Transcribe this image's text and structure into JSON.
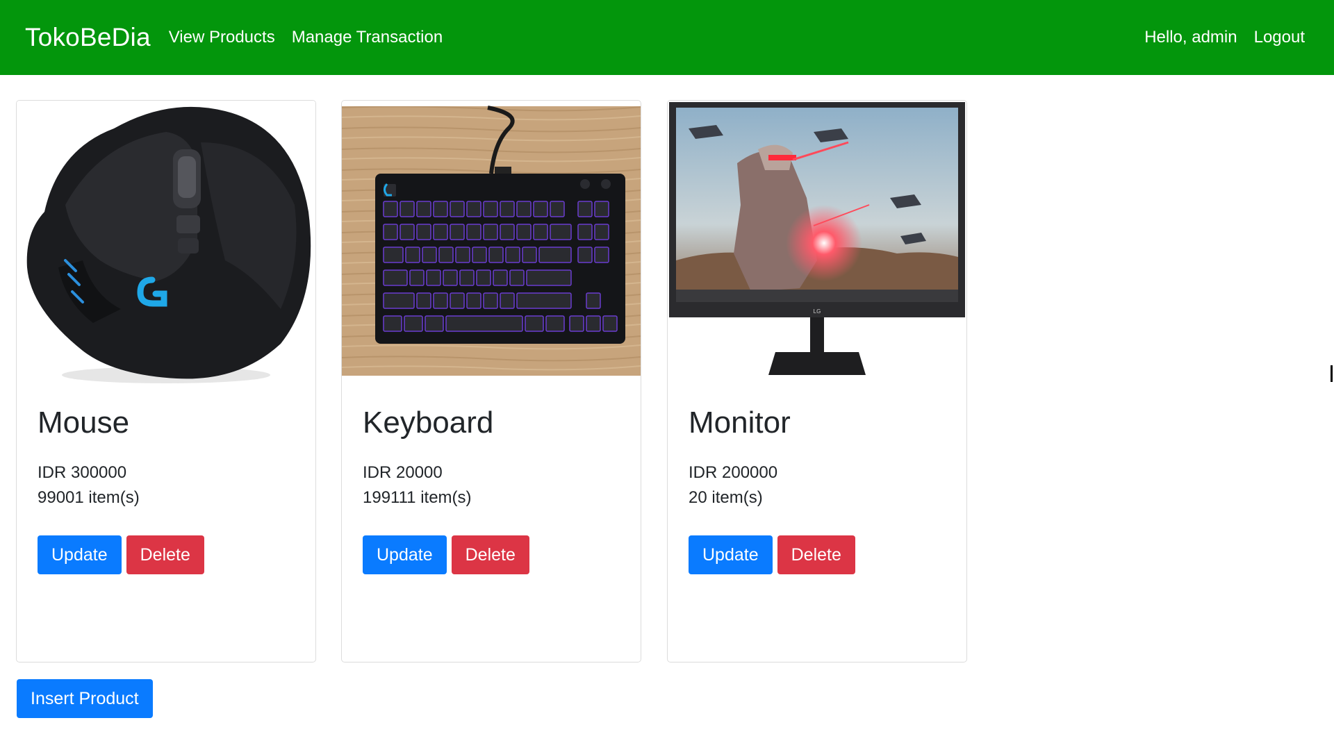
{
  "navbar": {
    "brand": "TokoBeDia",
    "links": [
      {
        "label": "View Products"
      },
      {
        "label": "Manage Transaction"
      }
    ],
    "greeting": "Hello, admin",
    "logout_label": "Logout",
    "background_color": "#03960c"
  },
  "products": [
    {
      "name": "Mouse",
      "price": "IDR 300000",
      "stock": "99001 item(s)",
      "image": "gaming-mouse-image",
      "update_label": "Update",
      "delete_label": "Delete"
    },
    {
      "name": "Keyboard",
      "price": "IDR 20000",
      "stock": "199111 item(s)",
      "image": "mechanical-keyboard-image",
      "update_label": "Update",
      "delete_label": "Delete"
    },
    {
      "name": "Monitor",
      "price": "IDR 200000",
      "stock": "20 item(s)",
      "image": "lcd-monitor-image",
      "update_label": "Update",
      "delete_label": "Delete"
    }
  ],
  "insert_product_label": "Insert Product",
  "colors": {
    "primary": "#0a7bff",
    "danger": "#dc3545",
    "navbar": "#03960c"
  }
}
